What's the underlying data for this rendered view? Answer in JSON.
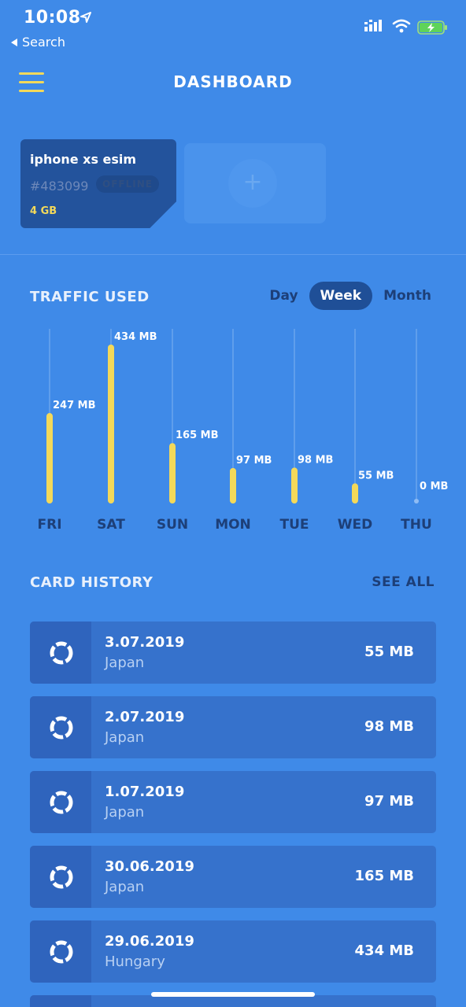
{
  "status_bar": {
    "time": "10:08",
    "back_label": "Search"
  },
  "header": {
    "title": "DASHBOARD"
  },
  "sim_card": {
    "name": "iphone xs esim",
    "id": "#483099",
    "status": "OFFLINE",
    "data": "4 GB"
  },
  "traffic": {
    "title": "TRAFFIC USED",
    "tabs": [
      {
        "label": "Day",
        "active": false
      },
      {
        "label": "Week",
        "active": true
      },
      {
        "label": "Month",
        "active": false
      }
    ]
  },
  "chart_data": {
    "type": "bar",
    "categories": [
      "FRI",
      "SAT",
      "SUN",
      "MON",
      "TUE",
      "WED",
      "THU"
    ],
    "values": [
      247,
      434,
      165,
      97,
      98,
      55,
      0
    ],
    "value_labels": [
      "247 MB",
      "434 MB",
      "165 MB",
      "97 MB",
      "98 MB",
      "55 MB",
      "0 MB"
    ],
    "unit": "MB",
    "ylim": [
      0,
      434
    ],
    "bar_color": "#f3d95a"
  },
  "history": {
    "title": "CARD HISTORY",
    "see_all": "SEE ALL",
    "items": [
      {
        "date": "3.07.2019",
        "country": "Japan",
        "amount": "55 MB"
      },
      {
        "date": "2.07.2019",
        "country": "Japan",
        "amount": "98 MB"
      },
      {
        "date": "1.07.2019",
        "country": "Japan",
        "amount": "97 MB"
      },
      {
        "date": "30.06.2019",
        "country": "Japan",
        "amount": "165 MB"
      },
      {
        "date": "29.06.2019",
        "country": "Hungary",
        "amount": "434 MB"
      }
    ]
  },
  "colors": {
    "background": "#3f8ae8",
    "accent": "#f3d95a",
    "card": "#23539c",
    "tab_active": "#1f4f97"
  },
  "icons": {
    "menu": "hamburger-menu-icon",
    "history_item": "donut-progress-icon",
    "add": "plus-icon"
  }
}
